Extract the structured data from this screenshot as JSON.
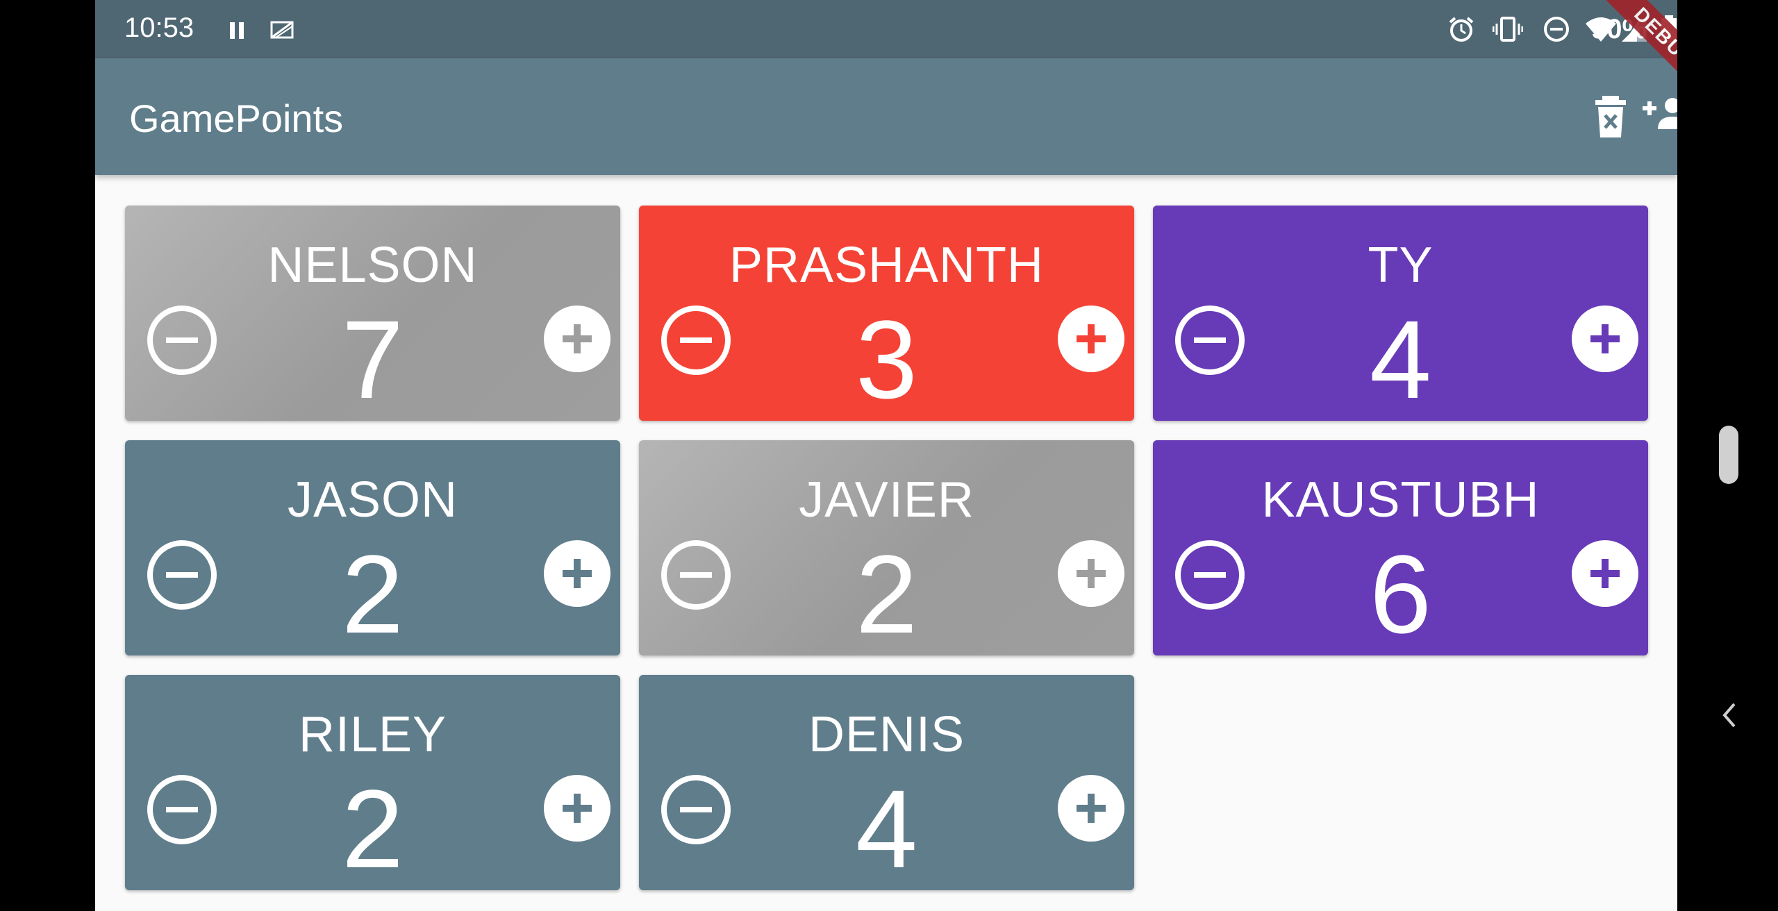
{
  "status_bar": {
    "time": "10:53",
    "battery_percent": "90%",
    "icons": [
      "pause-icon",
      "no-sim-icon",
      "alarm-icon",
      "vibrate-icon",
      "dnd-icon",
      "wifi-icon",
      "signal-icon",
      "battery-icon"
    ]
  },
  "app_bar": {
    "title": "GamePoints",
    "actions": [
      "delete-all-icon",
      "add-player-icon"
    ],
    "debug_label": "DEBUG"
  },
  "colors": {
    "status_bar": "#4f6773",
    "app_bar": "#607d8b",
    "gray": "#9e9e9e",
    "red": "#f44336",
    "purple": "#673ab7",
    "bluegray": "#607d8b"
  },
  "players": [
    {
      "name": "NELSON",
      "score": "7",
      "color": "#9e9e9e"
    },
    {
      "name": "PRASHANTH",
      "score": "3",
      "color": "#f44336"
    },
    {
      "name": "TY",
      "score": "4",
      "color": "#673ab7"
    },
    {
      "name": "JASON",
      "score": "2",
      "color": "#607d8b"
    },
    {
      "name": "JAVIER",
      "score": "2",
      "color": "#9e9e9e"
    },
    {
      "name": "KAUSTUBH",
      "score": "6",
      "color": "#673ab7"
    },
    {
      "name": "RILEY",
      "score": "2",
      "color": "#607d8b"
    },
    {
      "name": "DENIS",
      "score": "4",
      "color": "#607d8b"
    }
  ]
}
